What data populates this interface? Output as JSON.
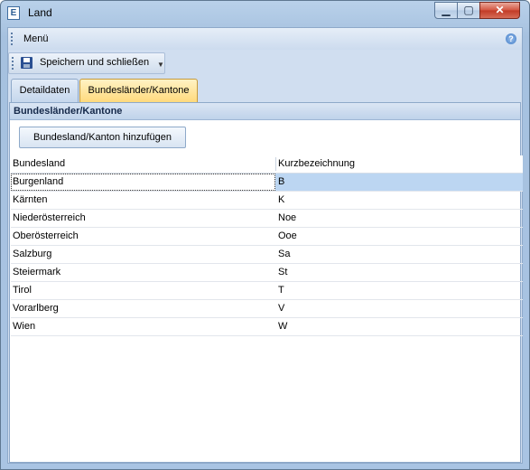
{
  "window": {
    "title": "Land",
    "app_icon": "E"
  },
  "menubar": {
    "label": "Menü",
    "help_glyph": "?"
  },
  "toolbar": {
    "save_label": "Speichern und schließen"
  },
  "tabs": [
    {
      "label": "Detaildaten",
      "active": false
    },
    {
      "label": "Bundesländer/Kantone",
      "active": true
    }
  ],
  "group": {
    "title": "Bundesländer/Kantone",
    "add_button": "Bundesland/Kanton hinzufügen"
  },
  "grid": {
    "columns": [
      "Bundesland",
      "Kurzbezeichnung"
    ],
    "rows": [
      [
        "Burgenland",
        "B"
      ],
      [
        "Kärnten",
        "K"
      ],
      [
        "Niederösterreich",
        "Noe"
      ],
      [
        "Oberösterreich",
        "Ooe"
      ],
      [
        "Salzburg",
        "Sa"
      ],
      [
        "Steiermark",
        "St"
      ],
      [
        "Tirol",
        "T"
      ],
      [
        "Vorarlberg",
        "V"
      ],
      [
        "Wien",
        "W"
      ]
    ],
    "selected_row": 0
  }
}
